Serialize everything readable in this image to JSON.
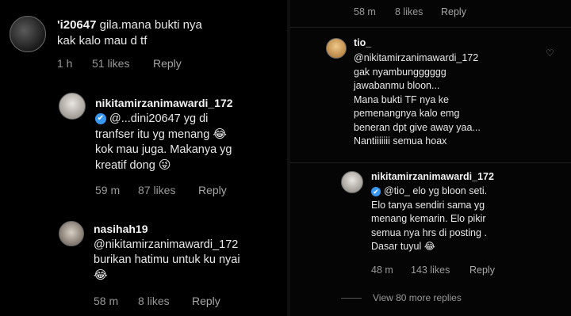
{
  "left": {
    "comment1": {
      "handle": "'i20647",
      "text_line1": "gila.mana bukti nya",
      "text_line2": "kak kalo mau d tf",
      "time": "1 h",
      "likes": "51 likes",
      "reply": "Reply"
    },
    "comment2": {
      "handle": "nikitamirzanimawardi_172",
      "mention": "@...dini20647",
      "text_line1_rest": "yg di",
      "text_line2": "tranfser itu yg menang",
      "text_line3": "kok mau juga. Makanya yg",
      "text_line4": "kreatif dong",
      "time": "59 m",
      "likes": "87 likes",
      "reply": "Reply"
    },
    "comment3": {
      "handle": "nasihah19",
      "text_line1": "@nikitamirzanimawardi_172",
      "text_line2": "burikan hatimu untuk ku nyai",
      "time": "58 m",
      "likes": "8 likes",
      "reply": "Reply"
    }
  },
  "right": {
    "top_meta": {
      "time": "58 m",
      "likes": "8 likes",
      "reply": "Reply"
    },
    "comment1": {
      "handle": "tio_",
      "text_line1": "@nikitamirzanimawardi_172",
      "text_line2": "gak nyambungggggg",
      "text_line3": "jawabanmu bloon...",
      "text_line4": "Mana bukti TF nya ke",
      "text_line5": "pemenangnya kalo emg",
      "text_line6": "beneran dpt give away yaa...",
      "text_line7": "Nantiiiiiii semua hoax"
    },
    "comment2": {
      "handle": "nikitamirzanimawardi_172",
      "mention": "@tio_",
      "text_line1_rest": "elo yg bloon seti.",
      "text_line2": "Elo tanya sendiri sama yg",
      "text_line3": "menang kemarin. Elo pikir",
      "text_line4": "semua nya hrs di posting .",
      "text_line5": "Dasar tuyul",
      "time": "48 m",
      "likes": "143 likes",
      "reply": "Reply"
    },
    "view_more": "View 80 more replies"
  },
  "icons": {
    "verified": "✔",
    "heart": "♡",
    "laugh_emoji": "😂",
    "tongue_emoji": "😜",
    "chevron": "‹"
  }
}
